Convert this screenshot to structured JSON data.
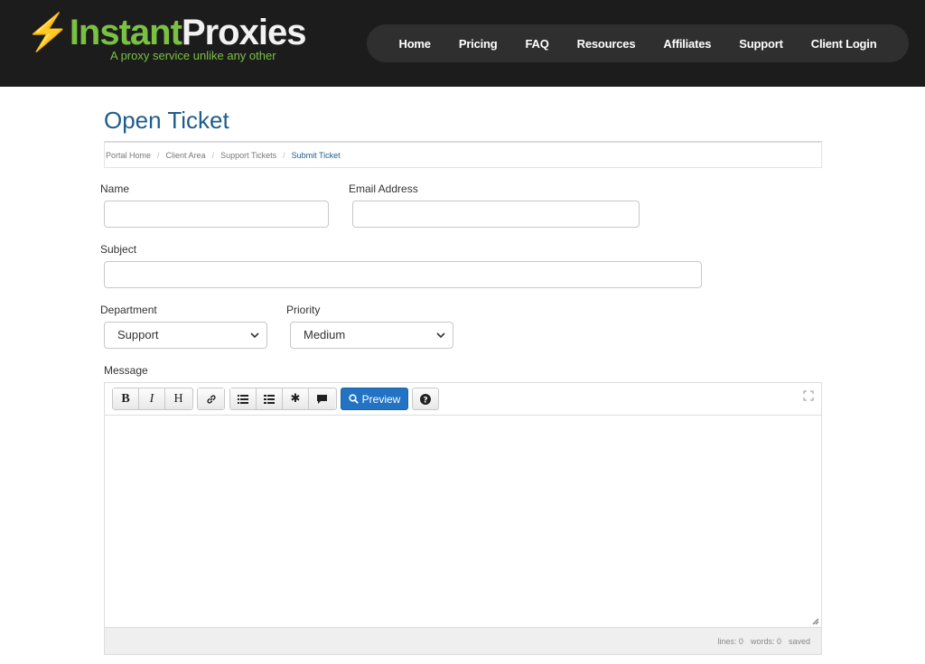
{
  "brand": {
    "logo_first": "Instant",
    "logo_second": "Proxies",
    "tagline": "A proxy service unlike any other",
    "accent_color": "#7ac143"
  },
  "nav": {
    "items": [
      "Home",
      "Pricing",
      "FAQ",
      "Resources",
      "Affiliates",
      "Support",
      "Client Login"
    ]
  },
  "page": {
    "title": "Open Ticket",
    "title_color": "#1e5d8c"
  },
  "breadcrumb": [
    "Portal Home",
    "Client Area",
    "Support Tickets",
    "Submit Ticket"
  ],
  "form": {
    "name_label": "Name",
    "name_value": "",
    "email_label": "Email Address",
    "email_value": "",
    "subject_label": "Subject",
    "subject_value": "",
    "department_label": "Department",
    "department_value": "Support",
    "priority_label": "Priority",
    "priority_value": "Medium",
    "message_label": "Message"
  },
  "editor": {
    "toolbar_icons": [
      "bold-icon",
      "italic-icon",
      "heading-icon",
      "link-icon",
      "unordered-list-icon",
      "ordered-list-icon",
      "asterisk-icon",
      "quote-icon",
      "search-icon",
      "help-icon",
      "fullscreen-icon"
    ],
    "bold_label": "B",
    "italic_label": "I",
    "heading_label": "H",
    "preview_label": "Preview",
    "preview_color": "#2273c3",
    "status_lines": "lines: 0",
    "status_words": "words: 0",
    "status_saved": "saved"
  }
}
